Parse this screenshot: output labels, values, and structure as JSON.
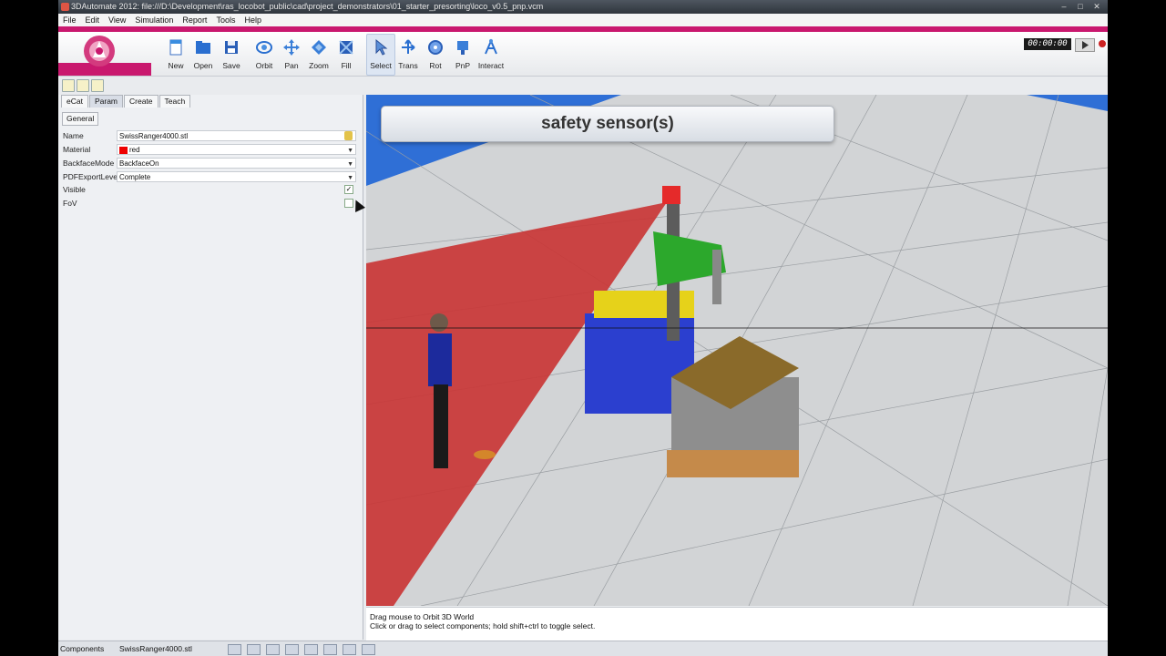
{
  "window": {
    "title": "3DAutomate 2012: file:///D:\\Development\\ras_locobot_public\\cad\\project_demonstrators\\01_starter_presorting\\loco_v0.5_pnp.vcm"
  },
  "menu": [
    "File",
    "Edit",
    "View",
    "Simulation",
    "Report",
    "Tools",
    "Help"
  ],
  "toolbar": {
    "new": "New",
    "open": "Open",
    "save": "Save",
    "orbit": "Orbit",
    "pan": "Pan",
    "zoom": "Zoom",
    "fill": "Fill",
    "select": "Select",
    "trans": "Trans",
    "rot": "Rot",
    "pnp": "PnP",
    "interact": "Interact"
  },
  "clock": "00:00:00",
  "tabs": [
    "eCat",
    "Param",
    "Create",
    "Teach"
  ],
  "general_tab": "General",
  "properties": {
    "name_label": "Name",
    "name_value": "SwissRanger4000.stl",
    "material_label": "Material",
    "material_value": "red",
    "backface_label": "BackfaceMode",
    "backface_value": "BackfaceOn",
    "pdf_label": "PDFExportLevel",
    "pdf_value": "Complete",
    "visible_label": "Visible",
    "fov_label": "FoV"
  },
  "banner": "safety sensor(s)",
  "status": {
    "line1": "Drag mouse to Orbit 3D World",
    "line2": "Click or drag to select components; hold shift+ctrl to toggle select."
  },
  "bottom": {
    "components": "Components",
    "selected": "SwissRanger4000.stl"
  },
  "colors": {
    "accent": "#c9186e",
    "floor": "#d4d6d8",
    "sky": "#2f6fd6",
    "fov": "#c93636",
    "material": "#e00000"
  },
  "icons": {
    "new": "new-file-icon",
    "open": "open-folder-icon",
    "save": "floppy-icon",
    "orbit": "orbit-icon",
    "pan": "pan-icon",
    "zoom": "zoom-icon",
    "fill": "fill-icon",
    "select": "cursor-icon",
    "trans": "translate-icon",
    "rot": "rotate-icon",
    "pnp": "pick-and-place-icon",
    "interact": "interact-icon"
  }
}
